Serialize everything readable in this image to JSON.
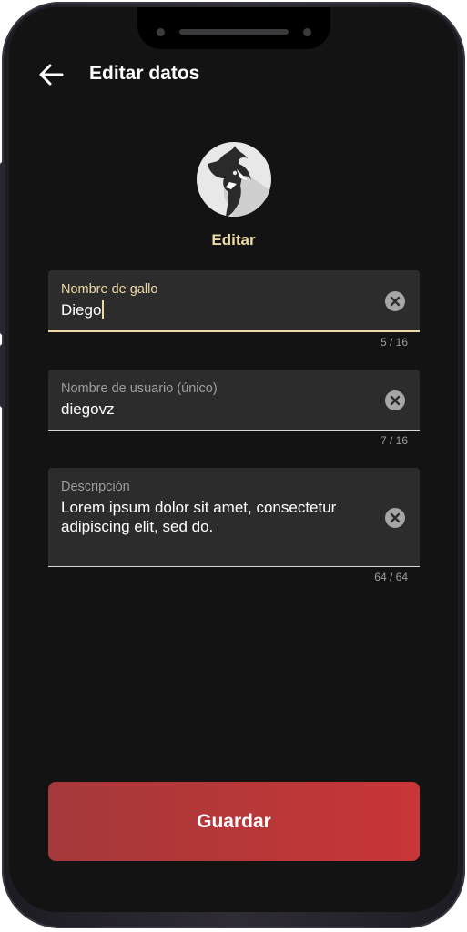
{
  "header": {
    "back_icon": "arrow-left-icon",
    "title": "Editar datos"
  },
  "profile": {
    "avatar_icon": "rooster-icon",
    "edit_label": "Editar"
  },
  "form": {
    "fields": [
      {
        "label": "Nombre de gallo",
        "value": "Diego",
        "counter": "5 / 16",
        "focused": true,
        "clear_icon": "clear-circle-icon"
      },
      {
        "label": "Nombre de usuario (único)",
        "value": "diegovz",
        "counter": "7 / 16",
        "focused": false,
        "clear_icon": "clear-circle-icon"
      },
      {
        "label": "Descripción",
        "value": "Lorem ipsum dolor sit amet, consectetur adipiscing elit, sed do.",
        "counter": "64 / 64",
        "focused": false,
        "clear_icon": "clear-circle-icon"
      }
    ]
  },
  "actions": {
    "save_label": "Guardar"
  },
  "colors": {
    "accent": "#ecd9a3",
    "background": "#141314",
    "field_background": "#2d2c2d",
    "button_gradient_start": "#a4383a",
    "button_gradient_end": "#c93637"
  }
}
